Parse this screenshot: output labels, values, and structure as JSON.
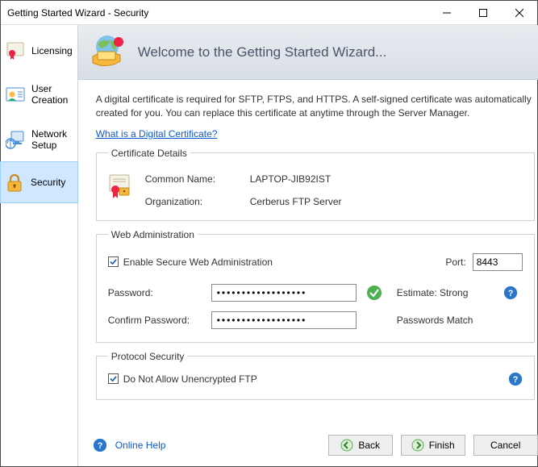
{
  "titlebar": {
    "title": "Getting Started Wizard - Security"
  },
  "sidebar": {
    "items": [
      {
        "label": "Licensing"
      },
      {
        "label": "User Creation"
      },
      {
        "label": "Network Setup"
      },
      {
        "label": "Security"
      }
    ]
  },
  "banner": {
    "title": "Welcome to the Getting Started Wizard..."
  },
  "content": {
    "intro": "A digital certificate is required for SFTP, FTPS, and HTTPS.  A self-signed certificate was automatically created for you.  You can replace this certificate at anytime through the Server Manager.",
    "link_what_is": "What is a Digital Certificate?",
    "cert": {
      "legend": "Certificate Details",
      "common_name_label": "Common Name:",
      "common_name_value": "LAPTOP-JIB92IST",
      "organization_label": "Organization:",
      "organization_value": "Cerberus FTP Server"
    },
    "web": {
      "legend": "Web Administration",
      "enable_label": "Enable Secure Web Administration",
      "port_label": "Port:",
      "port_value": "8443",
      "password_label": "Password:",
      "password_value": "••••••••••••••••••",
      "confirm_label": "Confirm Password:",
      "confirm_value": "••••••••••••••••••",
      "estimate_label": "Estimate: Strong",
      "match_label": "Passwords Match"
    },
    "proto": {
      "legend": "Protocol Security",
      "no_unencrypted_label": "Do Not Allow Unencrypted FTP"
    }
  },
  "footer": {
    "online_help": "Online Help",
    "back": "Back",
    "finish": "Finish",
    "cancel": "Cancel"
  }
}
